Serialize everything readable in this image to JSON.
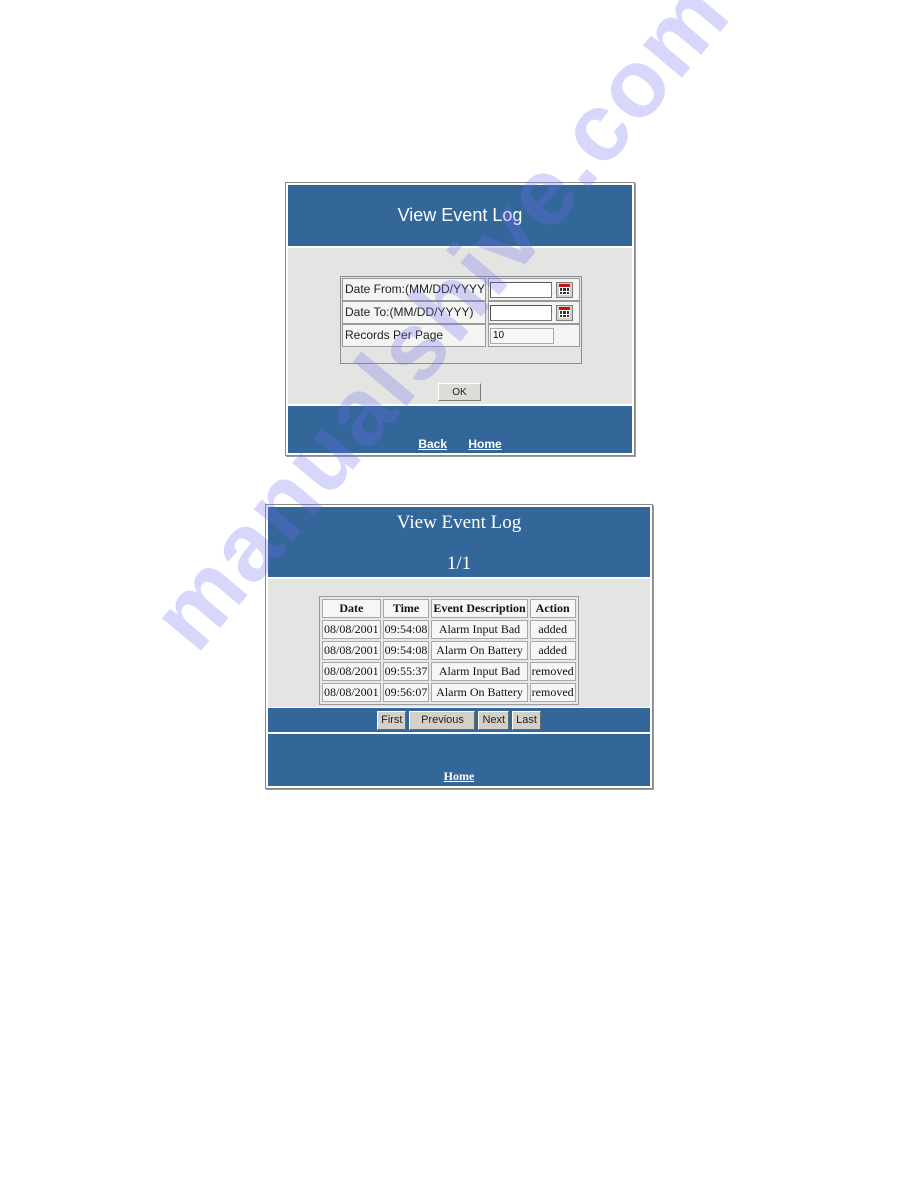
{
  "watermark": "manualshive.com",
  "date_form": {
    "title": "View Event Log",
    "fields": [
      {
        "label": "Date From:(MM/DD/YYYY)",
        "value": "",
        "icon": "calendar-icon"
      },
      {
        "label": "Date To:(MM/DD/YYYY)",
        "value": "",
        "icon": "calendar-icon"
      },
      {
        "label": "Records Per Page",
        "value": "10"
      }
    ],
    "ok_label": "OK",
    "links": {
      "back": "Back",
      "home": "Home"
    }
  },
  "event_log": {
    "title": "View Event Log",
    "page_indicator": "1/1",
    "columns": [
      "Date",
      "Time",
      "Event Description",
      "Action"
    ],
    "rows": [
      {
        "date": "08/08/2001",
        "time": "09:54:08",
        "event": "Alarm Input Bad",
        "action": "added"
      },
      {
        "date": "08/08/2001",
        "time": "09:54:08",
        "event": "Alarm On Battery",
        "action": "added"
      },
      {
        "date": "08/08/2001",
        "time": "09:55:37",
        "event": "Alarm Input Bad",
        "action": "removed"
      },
      {
        "date": "08/08/2001",
        "time": "09:56:07",
        "event": "Alarm On Battery",
        "action": "removed"
      }
    ],
    "nav": {
      "first": "First",
      "previous": "Previous",
      "next": "Next",
      "last": "Last"
    },
    "home_link": "Home"
  },
  "colors": {
    "header_blue": "#336699",
    "body_grey": "#e4e4e2"
  }
}
